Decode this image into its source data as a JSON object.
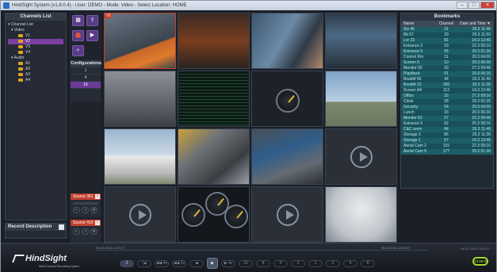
{
  "window": {
    "title": "HindSight System (v1.8.0.4) - User: DEMO - Mode: Video - Select Location: HOME"
  },
  "channels": {
    "header": "Channels List",
    "root": "Channel List",
    "video_group": "Video",
    "video_items": [
      "V1",
      "V2",
      "V3",
      "V4"
    ],
    "audio_group": "Audio",
    "audio_items": [
      "A1",
      "A2",
      "A3",
      "A4"
    ]
  },
  "record_description": {
    "header": "Record Description"
  },
  "tools": {
    "configurations_header": "Configurations",
    "config_items": [
      "1",
      "4",
      "16"
    ],
    "sources": [
      {
        "label": "Source 361"
      },
      {
        "label": "Source 410"
      }
    ]
  },
  "grid": {
    "selected_tile_label": "V1",
    "scene_colors": {
      "industrial": "#4f5c6a",
      "orange": "#8a4a22",
      "office": "#55738d",
      "control": "#2f3b47",
      "refinery": "#6c6f72",
      "building": "#8aa2b8",
      "pipes": "#505659",
      "empty": "#2b3038"
    }
  },
  "bookmarks": {
    "header": "Bookmarks",
    "columns": [
      "Name",
      "Channel",
      "Date and Time ▼"
    ],
    "rows": [
      {
        "name": "Sis 45",
        "channel": "21",
        "time": "29.3 11:46"
      },
      {
        "name": "Bit 67",
        "channel": "29",
        "time": "29.3 11:50"
      },
      {
        "name": "Lor 23",
        "channel": "81",
        "time": "14.3 12:46"
      },
      {
        "name": "Entrance 2",
        "channel": "33",
        "time": "22.3 09:10"
      },
      {
        "name": "Entrance 5",
        "channel": "55",
        "time": "29.3 01:36"
      },
      {
        "name": "Control Rm",
        "channel": "11",
        "time": "20.3 04:00"
      },
      {
        "name": "Screen 6",
        "channel": "10",
        "time": "29.3 06:00"
      },
      {
        "name": "Monitor 66",
        "channel": "09",
        "time": "27.3 09:46"
      },
      {
        "name": "PlayBack",
        "channel": "01",
        "time": "29.3 06:16"
      },
      {
        "name": "BookM 66",
        "channel": "44",
        "time": "29.3 11:46"
      },
      {
        "name": "BookM 22",
        "channel": "250",
        "time": "29.3 11:36"
      },
      {
        "name": "Screen A4",
        "channel": "112",
        "time": "14.3 12:46"
      },
      {
        "name": "Office",
        "channel": "33",
        "time": "27.3 09:16"
      },
      {
        "name": "Clock",
        "channel": "28",
        "time": "29.3 01:35"
      },
      {
        "name": "Security",
        "channel": "54",
        "time": "29.3 04:50"
      },
      {
        "name": "Lunch",
        "channel": "33",
        "time": "29.3 06:30"
      },
      {
        "name": "Monitor 62",
        "channel": "27",
        "time": "22.3 09:46"
      },
      {
        "name": "Entrance 5",
        "channel": "62",
        "time": "25.3 08:16"
      },
      {
        "name": "C&C room",
        "channel": "84",
        "time": "29.3 11:46"
      },
      {
        "name": "Storage 3",
        "channel": "86",
        "time": "29.3 11:36"
      },
      {
        "name": "Storage 1",
        "channel": "67",
        "time": "14.3 12:46"
      },
      {
        "name": "Aerial Cam 2",
        "channel": "115",
        "time": "22.3 09:16"
      },
      {
        "name": "Aerial Cam 5",
        "channel": "177",
        "time": "29.3 01:36"
      }
    ]
  },
  "bottom": {
    "logo": "HindSight",
    "logo_sub": "Multi-Channel Recording System",
    "timeline_left": "06.10.2018 14:07:27",
    "timeline_right": "06.10.2018 14:08:27",
    "live_time": "06.10.2018 14:08:27",
    "speed": "2",
    "live_label": "14:08:28",
    "transport": [
      "|◀",
      "◀◀ 4x",
      "◀◀ 2x",
      "◀",
      "▶",
      "▶ 4x",
      "16",
      "8",
      "4",
      "2",
      "1",
      "2",
      "4",
      "8"
    ]
  }
}
